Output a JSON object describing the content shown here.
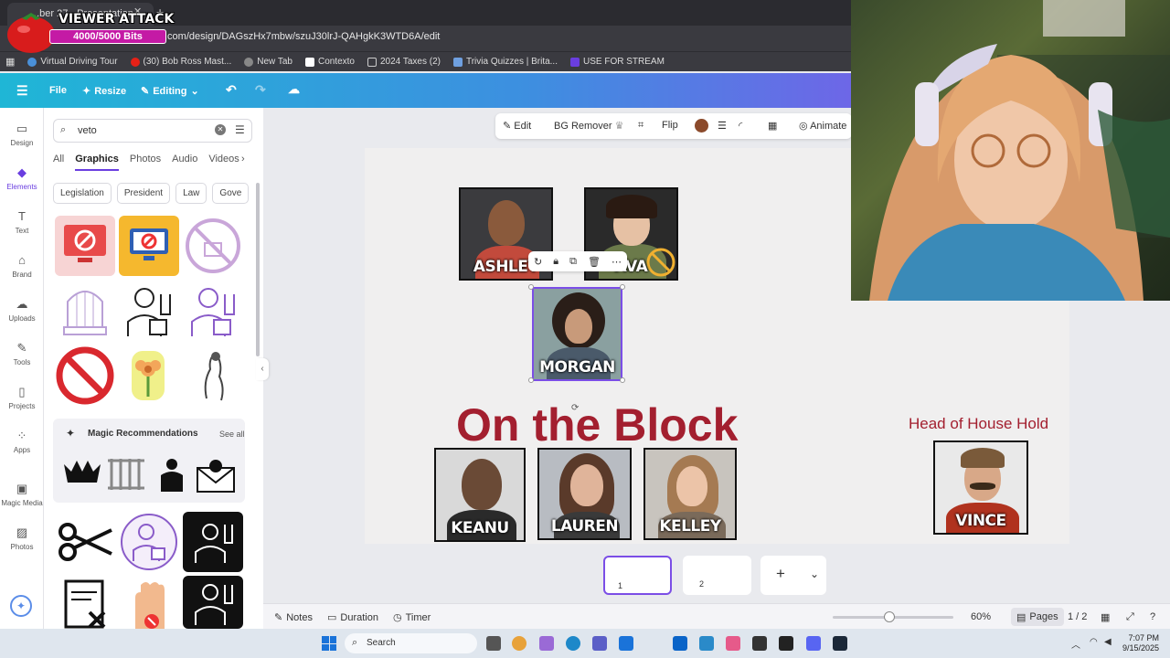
{
  "browser": {
    "tab_title": "...ber 27 - Presentation",
    "url": ".com/design/DAGszHx7mbw/szuJ30lrJ-QAHgkK3WTD6A/edit",
    "bookmarks": [
      "Virtual Driving Tour",
      "(30) Bob Ross Mast...",
      "New Tab",
      "Contexto",
      "2024 Taxes (2)",
      "Trivia Quizzes | Brita...",
      "USE FOR STREAM"
    ]
  },
  "overlay": {
    "title": "VIEWER ATTACK",
    "bits": "4000/5000 Bits"
  },
  "header": {
    "file": "File",
    "resize": "Resize",
    "editing": "Editing"
  },
  "rail": [
    {
      "label": "Design",
      "icon": "design-icon"
    },
    {
      "label": "Elements",
      "icon": "elements-icon"
    },
    {
      "label": "Text",
      "icon": "text-icon"
    },
    {
      "label": "Brand",
      "icon": "brand-icon"
    },
    {
      "label": "Uploads",
      "icon": "uploads-icon"
    },
    {
      "label": "Tools",
      "icon": "tools-icon"
    },
    {
      "label": "Projects",
      "icon": "projects-icon"
    },
    {
      "label": "Apps",
      "icon": "apps-icon"
    },
    {
      "label": "Magic Media",
      "icon": "magic-media-icon"
    },
    {
      "label": "Photos",
      "icon": "photos-icon"
    }
  ],
  "panel": {
    "search_value": "veto",
    "tabs": [
      "All",
      "Graphics",
      "Photos",
      "Audio",
      "Videos"
    ],
    "chips": [
      "Legislation",
      "President",
      "Law",
      "Gove"
    ],
    "magic_title": "Magic Recommendations",
    "see_all": "See all"
  },
  "toolbar": {
    "edit": "Edit",
    "bg_remover": "BG Remover",
    "flip": "Flip",
    "animate": "Animate",
    "color": "#8b4a2b"
  },
  "canvas": {
    "title": "On the Block",
    "head_of_household": "Head of House Hold",
    "people": {
      "ashley": "ASHLEY",
      "ava": "AVA",
      "morgan": "MORGAN",
      "keanu": "KEANU",
      "lauren": "LAUREN",
      "kelley": "KELLEY",
      "vince": "VINCE"
    },
    "accent_color": "#a31f2f"
  },
  "bottom": {
    "notes": "Notes",
    "duration": "Duration",
    "timer": "Timer",
    "zoom": "60%",
    "pages": "Pages",
    "page_count": "1 / 2",
    "thumb1_num": "1",
    "thumb2_num": "2"
  },
  "taskbar": {
    "search": "Search",
    "time": "7:07 PM",
    "date": "9/15/2025"
  }
}
